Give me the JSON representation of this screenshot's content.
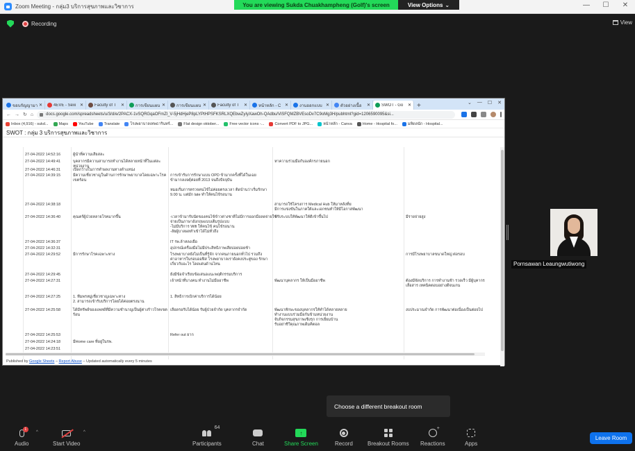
{
  "window": {
    "title": "Zoom Meeting - กลุ่ม3 บริการสุขภาพและวิชาการ",
    "minimize": "—",
    "maximize": "☐",
    "close": "✕"
  },
  "banner": {
    "viewing": "You are viewing Sukda Chuakhampheng (Golf)'s screen",
    "options": "View Options"
  },
  "status": {
    "recording": "Recording",
    "view": "View"
  },
  "browser": {
    "tabs": [
      {
        "label": "ขอบกัญญามาทร",
        "color": "#1a73e8"
      },
      {
        "label": "4EVE - Sexi",
        "color": "#e53935"
      },
      {
        "label": "Faculty of T",
        "color": "#6d4c41"
      },
      {
        "label": "การเขียนแผน",
        "color": "#0f9d58"
      },
      {
        "label": "การเขียนแผน",
        "color": "#555555"
      },
      {
        "label": "Faculty of T",
        "color": "#555555"
      },
      {
        "label": "หน้าหลัก - C",
        "color": "#1a73e8"
      },
      {
        "label": "งานออกแบบ",
        "color": "#1a73e8"
      },
      {
        "label": "ตัวอย่างเนื้อ",
        "color": "#4285f4"
      },
      {
        "label": "SWOT - Go",
        "color": "#0f9d58"
      }
    ],
    "new_tab": "+",
    "url": "docs.google.com/spreadsheets/u/3/d/e/2PACX-1vSQRGqaOFmZl_V-5jHdHjeP8pLYPtHPSFKSRLXQEbwZyIyXawOh-QAdbu/ViSFQMZBVEsoDv7C9oMg3H/pubhtml?gid=1206590095&si...",
    "bookmarks": [
      {
        "label": "Inbox (4,916) - sukd...",
        "color": "#ea4335"
      },
      {
        "label": "Maps",
        "color": "#34a853"
      },
      {
        "label": "YouTube",
        "color": "#ff0000"
      },
      {
        "label": "Translate",
        "color": "#4285f4"
      },
      {
        "label": "โรงพยาบาลเทพธารินทร์...",
        "color": "#4285f4"
      },
      {
        "label": "Flat design oktober...",
        "color": "#777777"
      },
      {
        "label": "Free vector icons -...",
        "color": "#23c16b"
      },
      {
        "label": "Convert PDF to JPG...",
        "color": "#e53935"
      },
      {
        "label": "หน้าหลัก - Canva",
        "color": "#00c4cc"
      },
      {
        "label": "Home - Hospital fo...",
        "color": "#555555"
      },
      {
        "label": "มหิดลนัก - Hospital...",
        "color": "#1a73e8"
      }
    ]
  },
  "sheet": {
    "title": "SWOT : กลุ่ม 3 บริการสุขภาพและวิชาการ",
    "rows": [
      {
        "date": "",
        "c1": "",
        "c2": "",
        "c3": "",
        "c4": ""
      },
      {
        "date": "27-04-2022 14:52:16",
        "c1": "ผู้นำที่ความเสียสละ",
        "c2": "",
        "c3": "",
        "c4": ""
      },
      {
        "date": "27-04-2022 14:49:41",
        "c1": "บุคลากรมีความสามารถทำงานได้หลายหน้าที่ในแต่ละ\nหน่วยงาน",
        "c2": "",
        "c3": "หาความร่วมมือกับองค์กรภายนอก",
        "c4": ""
      },
      {
        "date": "27-04-2022 14:46:31",
        "c1": "เปิดกว้างในการทำผลงานทางตำแหน่ง",
        "c2": "",
        "c3": "",
        "c4": ""
      },
      {
        "date": "27-04-2022 14:39:15",
        "c1": "มีความเชี่ยวชาญในด้านการรักษาพยาบาลโดยเฉพาะโรค\nเขตร้อน",
        "c2": "การเข้ารับการรักษาแบบ OPD ข้ามากครั้งที่ได้ในเฉย\nข้ามากลงจตุ์ค่อยที่ 2013 จนถึงปัจจุบัน\n\nหมอเริ่มการตรวจคนไข้ไม่ค่อยตรงเวลา ติดบ้านว่าเริ่มรักษา\n9.00 น. แต่มัก late ทำให้คนไข้รอนาน",
        "c3": "",
        "c4": ""
      },
      {
        "date": "27-04-2022 14:38:18",
        "c1": "",
        "c2": "",
        "c3": "สามารถใช้โครงการ Medical Hub ให้มาหลังที่ย\nมีการแข่งขันในภาคใต้และเอกชนทำให้มีโอกาสพัฒนา",
        "c4": ""
      },
      {
        "date": "27-04-2022 14:36:40",
        "c1": "คุณตร์ผู้ป่วยหลายโรคมากขึ้น",
        "c2": "-เวลาข้ามารับนัดของคนไข้ข้าวต่างชาติไม่มีการออกมือลดจ่ายใช้\nจ่ายเป็นภาษาอังกฤษแบบเต็มรูปแบบ\n-ไม่มีบริการ Wifi ให้คนไข้ คนไข้รอนาน\n-ลัยผู้บาลผลทำเข้าได้ไม่ทั่วถึง",
        "c3": "ปรับระบบให้พัฒนาให้ดีเข้าขึ้นไป",
        "c4": "มีรายจ่ายสูง"
      },
      {
        "date": "27-04-2022 14:36:37",
        "c1": "",
        "c2": "IT รพ.ล้าหลงเยือ",
        "c3": "",
        "c4": ""
      },
      {
        "date": "27-04-2022 14:32:31",
        "c1": "",
        "c2": "อุปกรณ์เครื่องมือไม่มีประสิทธิภาพเสียบ่อยบ่อยช้า",
        "c3": "",
        "c4": ""
      },
      {
        "date": "27-04-2022 14:29:52",
        "c1": "มีการรักษาโรคเฉพาะทาง",
        "c2": "โรงพยาบาลยังไม่เป็นที่รู้จัก จากคนภายนอกทั่วไป รวมถึง\nค่าอาหารในรอบออฟิส โรงพยาบาลเรายังคงประตู่ของ รักษา\nเกี่ยวกับอะไร โดดเด่นด้านไหน",
        "c3": "",
        "c4": "การมีโรงพยาบาลขนาดใหญ่ ต่อรอบ"
      },
      {
        "date": "27-04-2022 14:29:45",
        "c1": "",
        "c2": "ยังมีข้อจำเรียบข้อเสนอแนะพฤติกรรมบริการ",
        "c3": "",
        "c4": ""
      },
      {
        "date": "27-04-2022 14:27:31",
        "c1": "",
        "c2": "เจ้าหน้าที่บางคน ทำงานไม่มืออาชีพ",
        "c3": "พัฒนาบุคลากร ให้เป็นมืออาชีพ",
        "c4": "ต้องมีจัดบริการ การทำงานช้า รวดเร็ว มีผู้บุคากร\nเลื่อสาร เทคนิคตอบอย่างดีจนเกน"
      },
      {
        "date": "27-04-2022 14:27:25",
        "c1": "1. ทีมพรหมู่เชี่ยวชาญเฉพาะทาง\n2. สามารถเข้ารับบริการโดยได้ค่อยตรงนาน",
        "c2": "1. สิทธิการเบิกค่าบริการได้น้อย",
        "c3": "",
        "c4": ""
      },
      {
        "date": "27-04-2022 14:25:58",
        "c1": "ได้มีทรัพย์ของแพทย์ที่มีความชำนาญเป็นผู้ต่างร้าวโรคเขต\nร้อน",
        "c2": "เลือดรอรับได้น้อย รับผู้ป่วยจำกัด บุคลากรจำกัด",
        "c3": "พัฒนาทักษะของบุคลากรให้ทำได้หลายหลาย\nทำงานแบบร่วมมือกันข้ามหน่วยงาน\nจับกิจกรรมสุขภาพเชิงรุก การเยี่ยมบ้าน\nรับอย่าชีวีคุณภาพเดิมคิตอล",
        "c4": "งบประมาณจำกัด การพัฒนาต่อเนื่องเป็นต่อยไป"
      },
      {
        "date": "27-04-2022 14:25:53",
        "c1": "",
        "c2": "Refer out ยาก",
        "c3": "",
        "c4": ""
      },
      {
        "date": "27-04-2022 14:24:18",
        "c1": "มีHome care ที่อยู่ในรพ.",
        "c2": "",
        "c3": "",
        "c4": ""
      },
      {
        "date": "27-04-2022 14:23:51",
        "c1": "",
        "c2": "",
        "c3": "",
        "c4": ""
      }
    ],
    "published_prefix": "Published by",
    "published_by": "Google Sheets",
    "report": "Report Abuse",
    "updated": "– Updated automatically every 5 minutes"
  },
  "participant": {
    "name": "Pornsawan Leaungwutiwong"
  },
  "tooltip": "Choose a different breakout room",
  "toolbar": {
    "audio": "Audio",
    "audio_badge": "1",
    "video": "Start Video",
    "participants": "Participants",
    "participants_count": "64",
    "chat": "Chat",
    "share": "Share Screen",
    "record": "Record",
    "breakout": "Breakout Rooms",
    "reactions": "Reactions",
    "apps": "Apps",
    "leave": "Leave Room"
  },
  "colors": {
    "banner_green": "#23d959",
    "leave_blue": "#0e72ed",
    "background": "#1a1a1a"
  }
}
